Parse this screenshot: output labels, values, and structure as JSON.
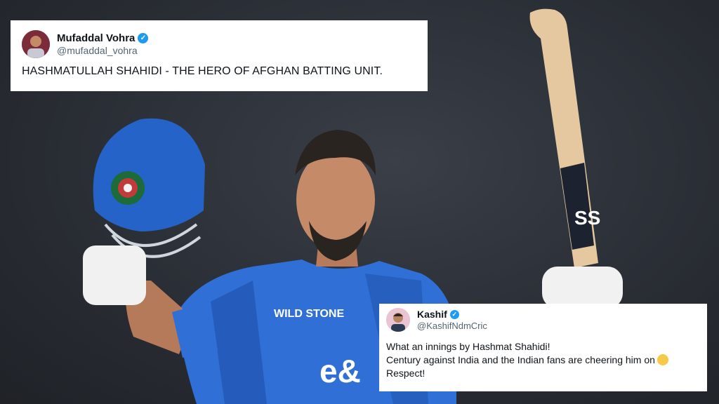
{
  "tweets": [
    {
      "name": "Mufaddal Vohra",
      "handle": "@mufaddal_vohra",
      "verified_icon": "verified-badge-icon",
      "lines": [
        "HASHMATULLAH SHAHIDI - THE HERO OF AFGHAN BATTING UNIT."
      ]
    },
    {
      "name": "Kashif",
      "handle": "@KashifNdmCric",
      "verified_icon": "verified-badge-icon",
      "lines": [
        "What an innings by Hashmat Shahidi!",
        "Century against India and the Indian fans are cheering him on",
        "Respect!"
      ],
      "emoji": "clapping-hands-icon"
    }
  ],
  "photo": {
    "jersey_text": "WILD STONE",
    "sponsor_text": "e&",
    "bat_brand": "SS",
    "jersey_color": "#2f6fd6",
    "helmet_color": "#2563c9"
  }
}
